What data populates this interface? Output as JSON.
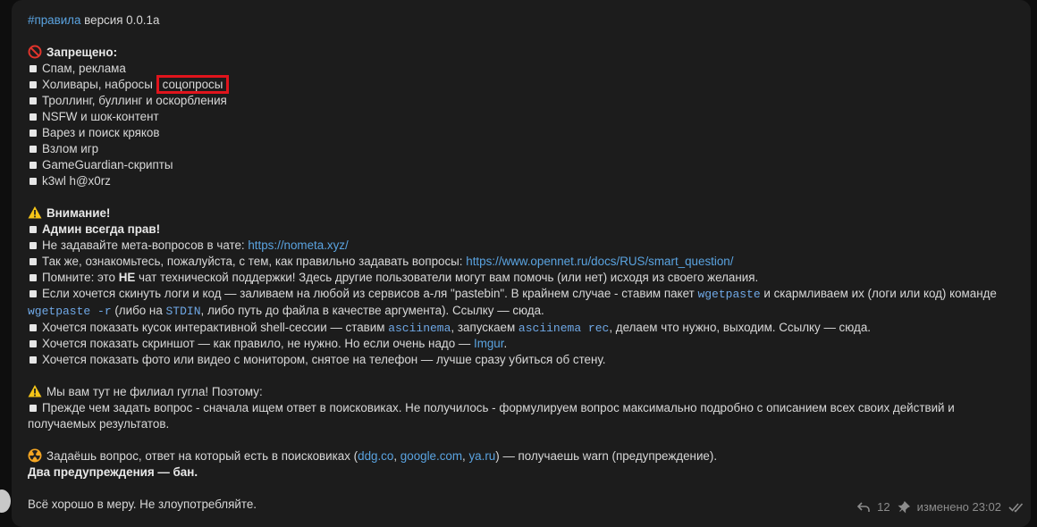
{
  "header": {
    "hashtag": "#правила",
    "version": " версия 0.0.1а"
  },
  "forbidden": {
    "title": "Запрещено:",
    "items": [
      "Спам, реклама",
      "Холивары, набросы",
      "Троллинг, буллинг и оскорбления",
      "NSFW и шок-контент",
      "Варез и поиск кряков",
      "Взлом игр",
      "GameGuardian-скрипты",
      "k3wl h@x0rz"
    ],
    "highlighted": "соцопросы"
  },
  "attention": {
    "title": "Внимание!",
    "admin": "Админ всегда прав!",
    "meta_text": "Не задавайте мета-вопросов в чате: ",
    "meta_link": "https://nometa.xyz/",
    "smart_text": "Так же, ознакомьтесь, пожалуйста, с тем, как правильно задавать вопросы: ",
    "smart_link": "https://www.opennet.ru/docs/RUS/smart_question/",
    "remember_a": "Помните: это ",
    "remember_b": "НЕ",
    "remember_c": " чат технической поддержки! Здесь другие пользователи могут вам помочь (или нет) исходя из своего желания.",
    "logs_a": "Если хочется скинуть логи и код — заливаем на любой из сервисов а-ля \"pastebin\". В крайнем случае - ставим пакет ",
    "logs_code1": "wgetpaste",
    "logs_b": " и скармливаем их (логи или код) команде ",
    "logs_code2": "wgetpaste -r",
    "logs_c": " (либо на ",
    "logs_code3": "STDIN",
    "logs_d": ", либо путь до файла в качестве аргумента). Ссылку — сюда.",
    "shell_a": "Хочется показать кусок интерактивной shell-сессии — ставим ",
    "shell_code1": "asciinema",
    "shell_b": ", запускаем ",
    "shell_code2": "asciinema rec",
    "shell_c": ", делаем что нужно, выходим. Ссылку — сюда.",
    "screenshot_a": "Хочется показать скриншот — как правило, не нужно. Но если очень надо — ",
    "screenshot_link": "Imgur",
    "screenshot_b": ".",
    "photo": "Хочется показать фото или видео с монитором, снятое на телефон — лучше сразу убиться об стену."
  },
  "google": {
    "title": "Мы вам тут не филиал гугла! Поэтому:",
    "item": "Прежде чем задать вопрос - сначала ищем ответ в поисковиках. Не получилось - формулируем вопрос максимально подробно с описанием всех своих действий и получаемых результатов."
  },
  "warn": {
    "text_a": "Задаёшь вопрос, ответ на который есть в поисковиках (",
    "link1": "ddg.co",
    "sep1": ", ",
    "link2": "google.com",
    "sep2": ", ",
    "link3": "ya.ru",
    "text_b": ") — получаешь warn (предупреждение).",
    "ban": "Два предупреждения — бан."
  },
  "closing": "Всё хорошо в меру. Не злоупотребляйте.",
  "footer": {
    "replies": "12",
    "edited": "изменено 23:02"
  }
}
